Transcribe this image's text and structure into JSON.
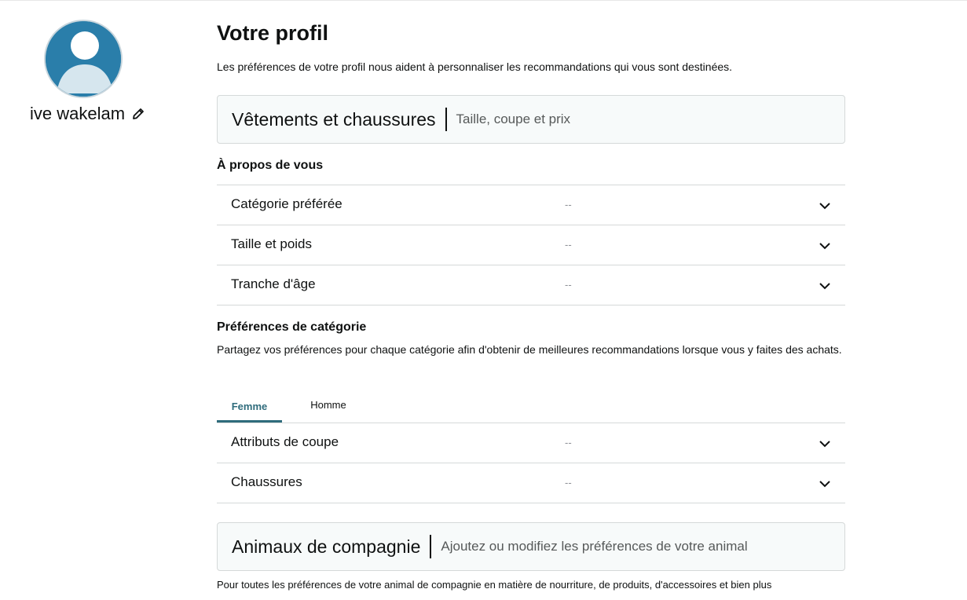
{
  "profile": {
    "user_name": "ive wakelam",
    "avatar_icon": "user-avatar-icon",
    "edit_icon": "pencil-icon"
  },
  "header": {
    "title": "Votre profil",
    "subtitle": "Les préférences de votre profil nous aident à personnaliser les recommandations qui vous sont destinées."
  },
  "clothing_section": {
    "title": "Vêtements et chaussures",
    "hint": "Taille, coupe et prix"
  },
  "about_you": {
    "heading": "À propos de vous",
    "items": [
      {
        "label": "Catégorie préférée",
        "value": "--"
      },
      {
        "label": "Taille et poids",
        "value": "--"
      },
      {
        "label": "Tranche d'âge",
        "value": "--"
      }
    ]
  },
  "category_prefs": {
    "heading": "Préférences de catégorie",
    "description": "Partagez vos préférences pour chaque catégorie afin d'obtenir de meilleures recommandations lorsque vous y faites des achats.",
    "tabs": [
      {
        "label": "Femme",
        "selected": true
      },
      {
        "label": "Homme",
        "selected": false
      }
    ],
    "items": [
      {
        "label": "Attributs de coupe",
        "value": "--"
      },
      {
        "label": "Chaussures",
        "value": "--"
      }
    ]
  },
  "pets_section": {
    "title": "Animaux de compagnie",
    "hint": "Ajoutez ou modifiez les préférences de votre animal",
    "note": "Pour toutes les préférences de votre animal de compagnie en matière de nourriture, de produits, d'accessoires et bien plus"
  },
  "colors": {
    "accent_tab": "#2f6c7c",
    "avatar_bg": "#2a7eaa",
    "card_bg": "#f7fafa",
    "border": "#d5d9d9"
  }
}
